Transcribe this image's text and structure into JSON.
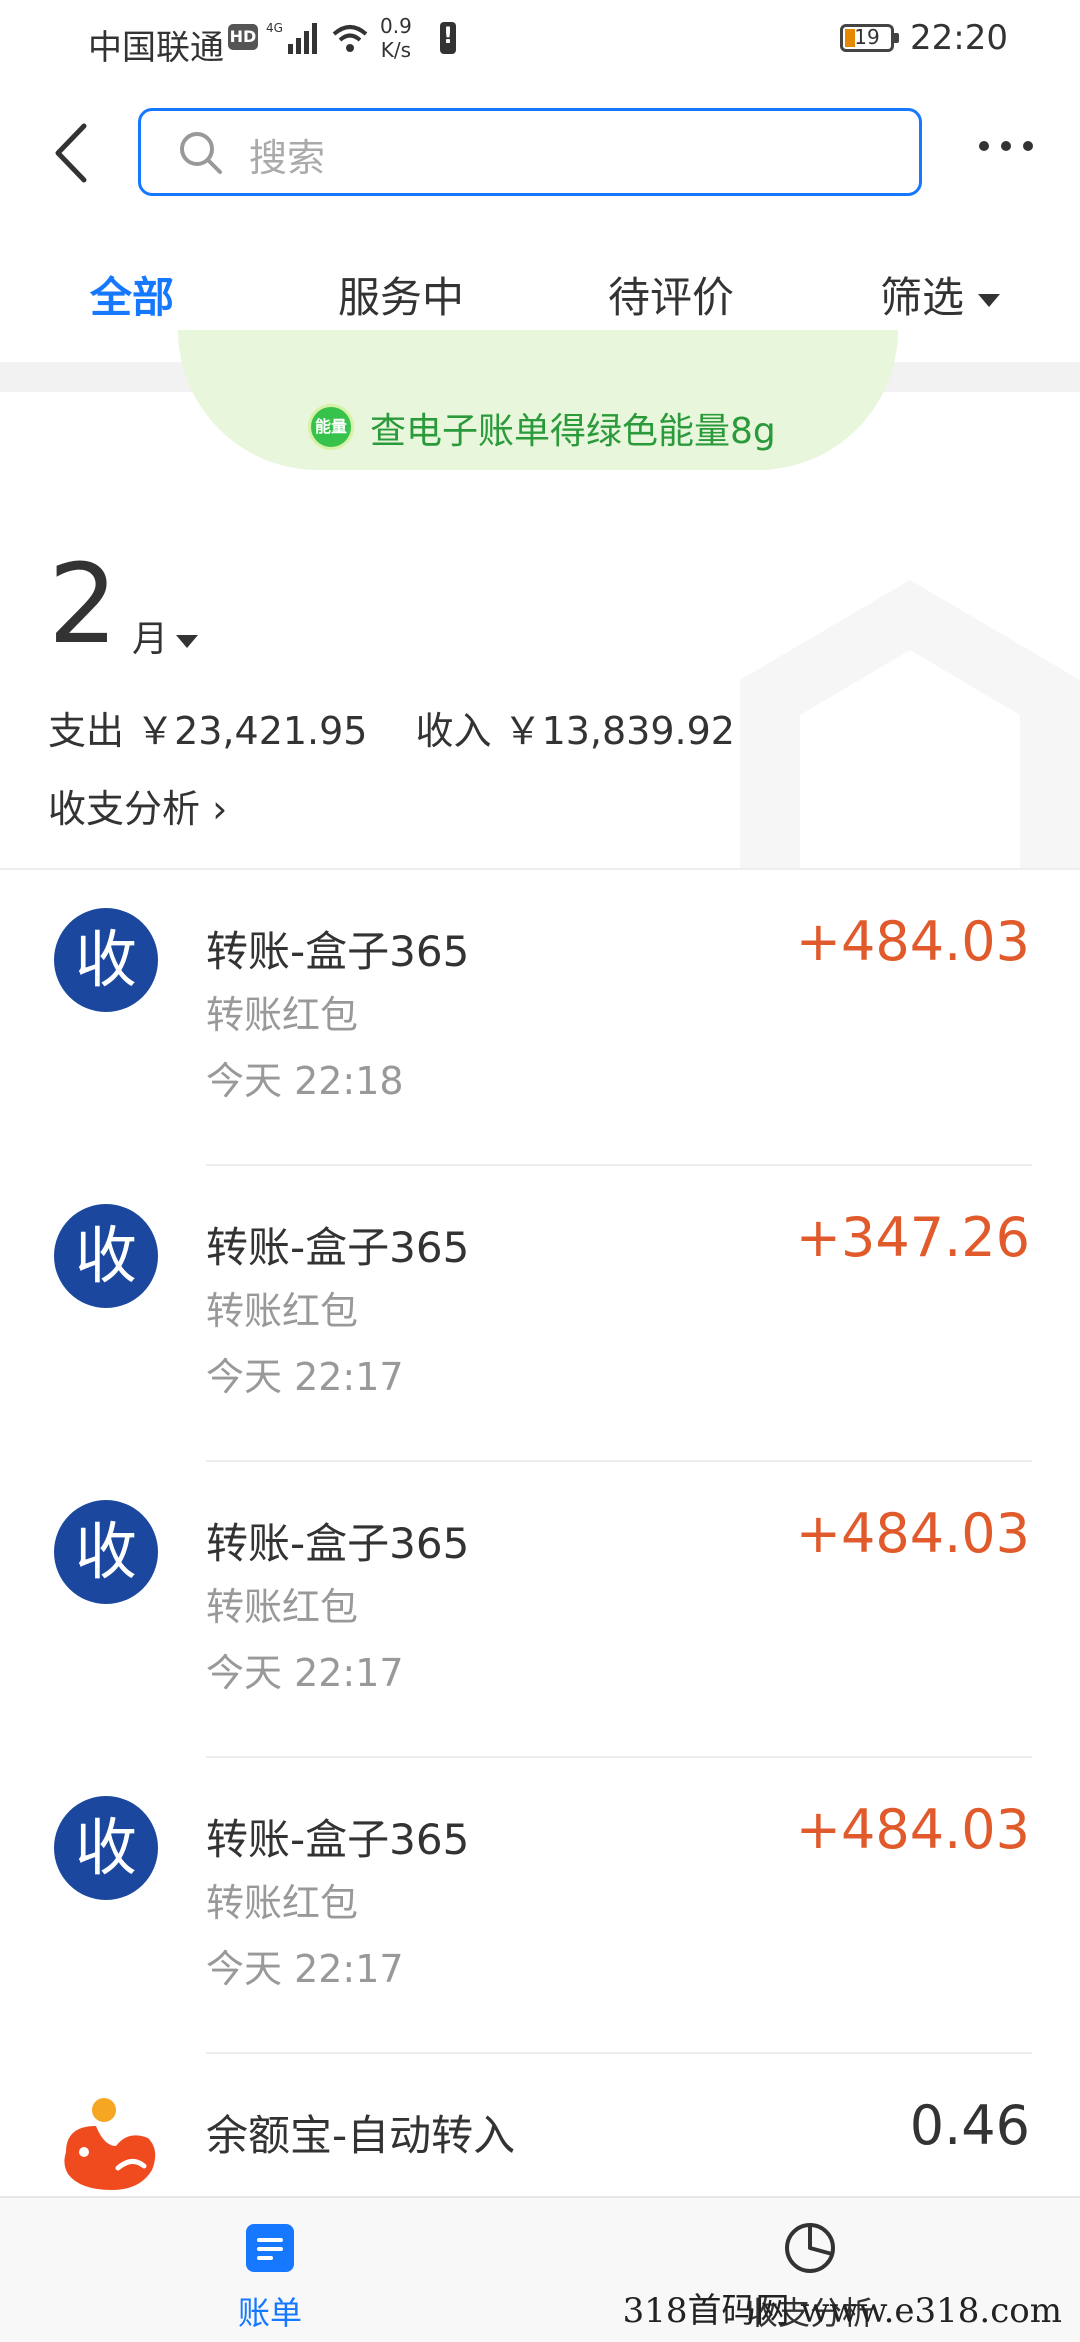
{
  "status_bar": {
    "carrier": "中国联通",
    "hd": "HD",
    "network": "4G",
    "speed_value": "0.9",
    "speed_unit": "K/s",
    "battery": "19",
    "time": "22:20"
  },
  "header": {
    "search_placeholder": "搜索"
  },
  "tabs": {
    "all": "全部",
    "in_service": "服务中",
    "to_review": "待评价",
    "filter": "筛选"
  },
  "banner": {
    "badge": "能量",
    "text": "查电子账单得绿色能量8g"
  },
  "month_summary": {
    "month": "2",
    "month_unit": "月",
    "expense": "支出 ￥23,421.95",
    "income": "收入 ￥13,839.92",
    "analysis_link": "收支分析 ›"
  },
  "transactions": [
    {
      "avatar": "收",
      "title": "转账-盒子365",
      "subtitle": "转账红包",
      "time": "今天  22:18",
      "amount": "+484.03"
    },
    {
      "avatar": "收",
      "title": "转账-盒子365",
      "subtitle": "转账红包",
      "time": "今天  22:17",
      "amount": "+347.26"
    },
    {
      "avatar": "收",
      "title": "转账-盒子365",
      "subtitle": "转账红包",
      "time": "今天  22:17",
      "amount": "+484.03"
    },
    {
      "avatar": "收",
      "title": "转账-盒子365",
      "subtitle": "转账红包",
      "time": "今天  22:17",
      "amount": "+484.03"
    },
    {
      "title": "余额宝-自动转入",
      "amount": "0.46"
    }
  ],
  "bottom_nav": {
    "bills": "账单",
    "analysis": "收支分析"
  },
  "watermark": "318首码网  www.e318.com",
  "colors": {
    "accent": "#1677ff",
    "income": "#e05a2b",
    "avatar": "#1b479e",
    "energy": "#2a9a3a"
  }
}
